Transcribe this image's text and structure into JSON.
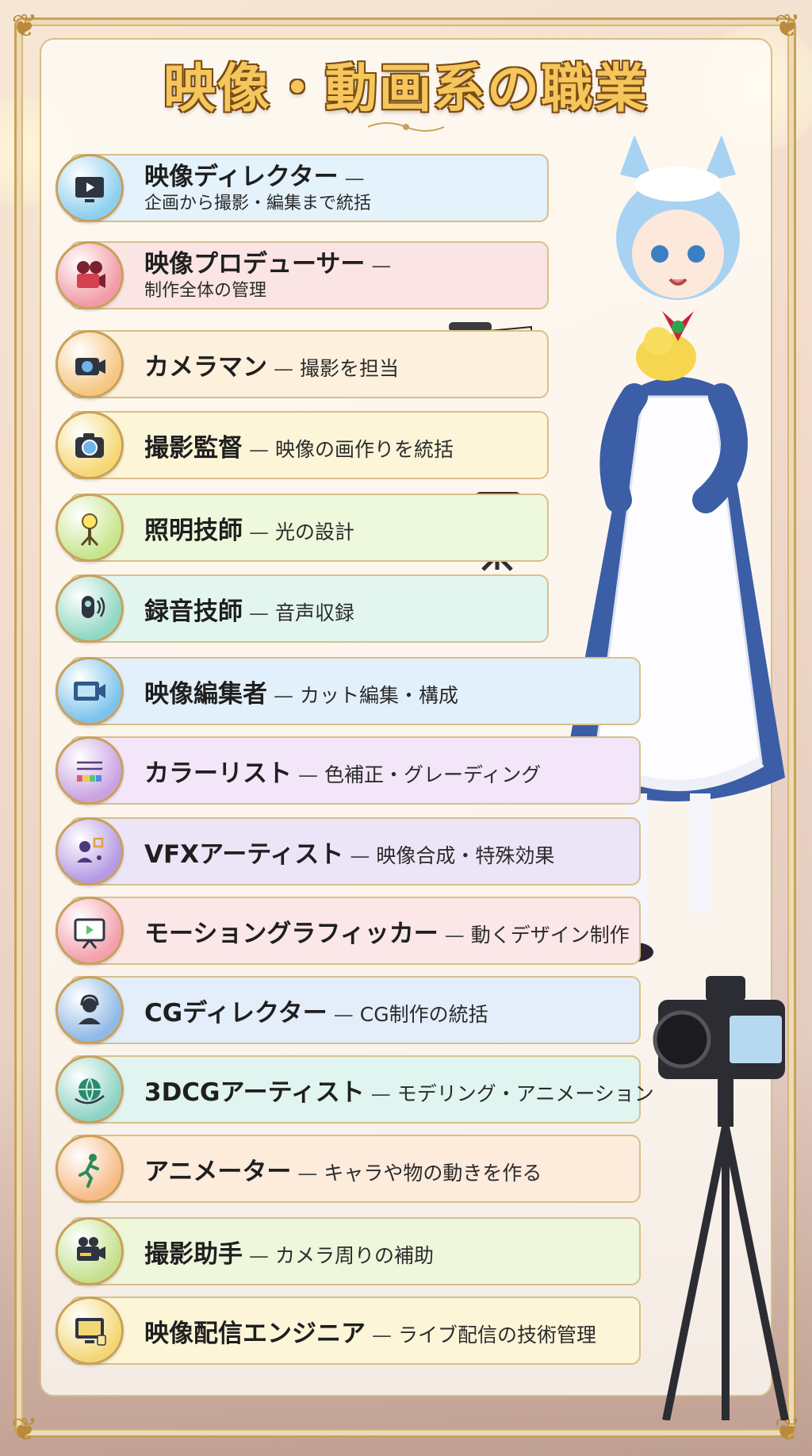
{
  "title": "映像・動画系の職業",
  "separator": "—",
  "jobs": [
    {
      "name": "映像ディレクター",
      "desc": "企画から撮影・編集まで統括",
      "icon": "tv-play-icon",
      "color": "#e4f2fb",
      "icon_bg": "#8ccff0"
    },
    {
      "name": "映像プロデューサー",
      "desc": "制作全体の管理",
      "icon": "film-camera-icon",
      "color": "#fbe4e4",
      "icon_bg": "#f29aa6"
    },
    {
      "name": "カメラマン",
      "desc": "撮影を担当",
      "icon": "video-camera-icon",
      "color": "#fdf0dc",
      "icon_bg": "#f6c681"
    },
    {
      "name": "撮影監督",
      "desc": "映像の画作りを統括",
      "icon": "photo-camera-icon",
      "color": "#fdf5d8",
      "icon_bg": "#f5d773"
    },
    {
      "name": "照明技師",
      "desc": "光の設計",
      "icon": "light-icon",
      "color": "#eef8dc",
      "icon_bg": "#c7e58c"
    },
    {
      "name": "録音技師",
      "desc": "音声収録",
      "icon": "microphone-icon",
      "color": "#e2f6ef",
      "icon_bg": "#8fd8c2"
    },
    {
      "name": "映像編集者",
      "desc": "カット編集・構成",
      "icon": "film-icon",
      "color": "#e2f0fb",
      "icon_bg": "#7cc3ec"
    },
    {
      "name": "カラーリスト",
      "desc": "色補正・グレーディング",
      "icon": "color-grading-icon",
      "color": "#f2e6f8",
      "icon_bg": "#c9a2e2"
    },
    {
      "name": "VFXアーティスト",
      "desc": "映像合成・特殊効果",
      "icon": "vfx-icon",
      "color": "#ece5f8",
      "icon_bg": "#b59ae3"
    },
    {
      "name": "モーショングラフィッカー",
      "desc": "動くデザイン制作",
      "icon": "motion-screen-icon",
      "color": "#fbe6e8",
      "icon_bg": "#f3a0ac"
    },
    {
      "name": "CGディレクター",
      "desc": "CG制作の統括",
      "icon": "headset-person-icon",
      "color": "#e3eefa",
      "icon_bg": "#8fb9e6"
    },
    {
      "name": "3DCGアーティスト",
      "desc": "モデリング・アニメーション",
      "icon": "3d-globe-icon",
      "color": "#e0f4f0",
      "icon_bg": "#8dd3c4"
    },
    {
      "name": "アニメーター",
      "desc": "キャラや物の動きを作る",
      "icon": "running-figure-icon",
      "color": "#fdebdc",
      "icon_bg": "#f6bb86"
    },
    {
      "name": "撮影助手",
      "desc": "カメラ周りの補助",
      "icon": "camera-assist-icon",
      "color": "#eef6dc",
      "icon_bg": "#c5e08c"
    },
    {
      "name": "映像配信エンジニア",
      "desc": "ライブ配信の技術管理",
      "icon": "monitor-icon",
      "color": "#fdf5d8",
      "icon_bg": "#f3d777"
    }
  ]
}
